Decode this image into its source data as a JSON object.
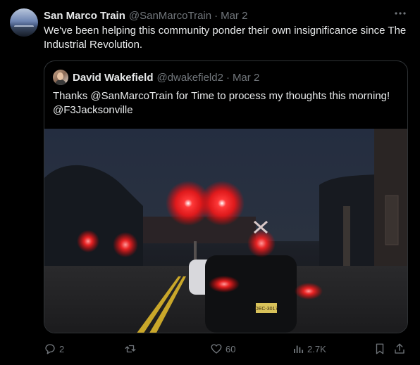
{
  "tweet": {
    "author_name": "San Marco Train",
    "author_handle": "@SanMarcoTrain",
    "separator": "·",
    "date": "Mar 2",
    "text": "We've been helping this community ponder their own insignificance since The Industrial Revolution.",
    "more_icon": "ellipsis-icon"
  },
  "quoted": {
    "author_name": "David Wakefield",
    "author_handle": "@dwakefield2",
    "separator": "·",
    "date": "Mar 2",
    "text_line1": "Thanks @SanMarcoTrain for Time to process my thoughts this morning!",
    "text_line2": "@F3Jacksonville",
    "plate": "DEC-3017"
  },
  "actions": {
    "reply_count": "2",
    "retweet_count": "",
    "like_count": "60",
    "views_count": "2.7K"
  },
  "colors": {
    "background": "#000000",
    "text": "#e7e9ea",
    "muted": "#71767b",
    "border": "#2f3336",
    "signal_red": "#ff2020"
  }
}
